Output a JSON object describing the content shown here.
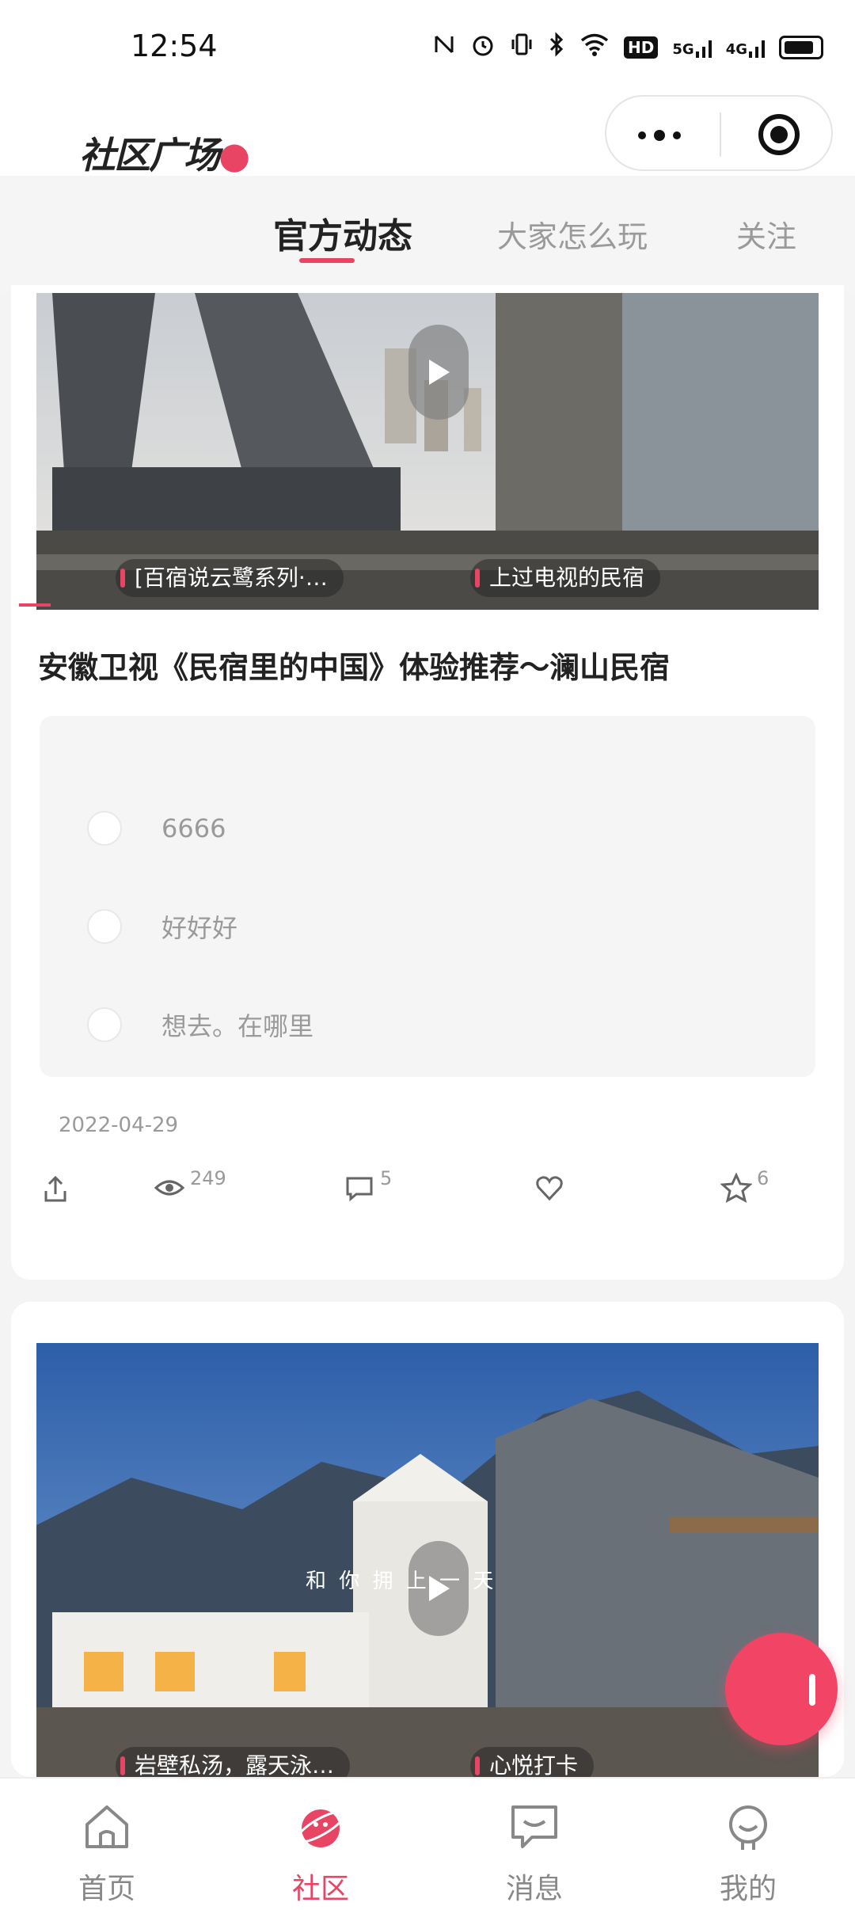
{
  "status_bar": {
    "time": "12:54",
    "icons": [
      "nfc-icon",
      "alarm-icon",
      "vibrate-icon",
      "bluetooth-icon",
      "wifi-icon",
      "hd-icon",
      "5g-signal-icon",
      "4g-signal-icon",
      "battery-icon"
    ],
    "hd_label": "HD",
    "net1": "5G",
    "net2": "4G"
  },
  "header": {
    "logo_text": "社区广场"
  },
  "tabs": [
    {
      "label": "官方动态",
      "active": true
    },
    {
      "label": "大家怎么玩",
      "active": false
    },
    {
      "label": "关注",
      "active": false
    }
  ],
  "posts": [
    {
      "tags": [
        "[百宿说云鹭系列·…",
        "上过电视的民宿"
      ],
      "title": "安徽卫视《民宿里的中国》体验推荐～澜山民宿",
      "comments": [
        "6666",
        "好好好",
        "想去。在哪里"
      ],
      "date": "2022-04-29",
      "views": "249",
      "comment_count": "5",
      "likes": "",
      "favorites": "6"
    },
    {
      "tags": [
        "岩壁私汤，露天泳…",
        "心悦打卡"
      ],
      "overlay_text": "和 你 拥 上 一 天"
    }
  ],
  "bottom_nav": [
    {
      "label": "首页",
      "icon": "home-icon",
      "active": false
    },
    {
      "label": "社区",
      "icon": "community-planet-icon",
      "active": true
    },
    {
      "label": "消息",
      "icon": "message-icon",
      "active": false
    },
    {
      "label": "我的",
      "icon": "profile-icon",
      "active": false
    }
  ],
  "colors": {
    "accent": "#e84565",
    "fab": "#f24566",
    "muted_text": "#9a9a9a",
    "comment_bg": "#f5f5f5"
  }
}
